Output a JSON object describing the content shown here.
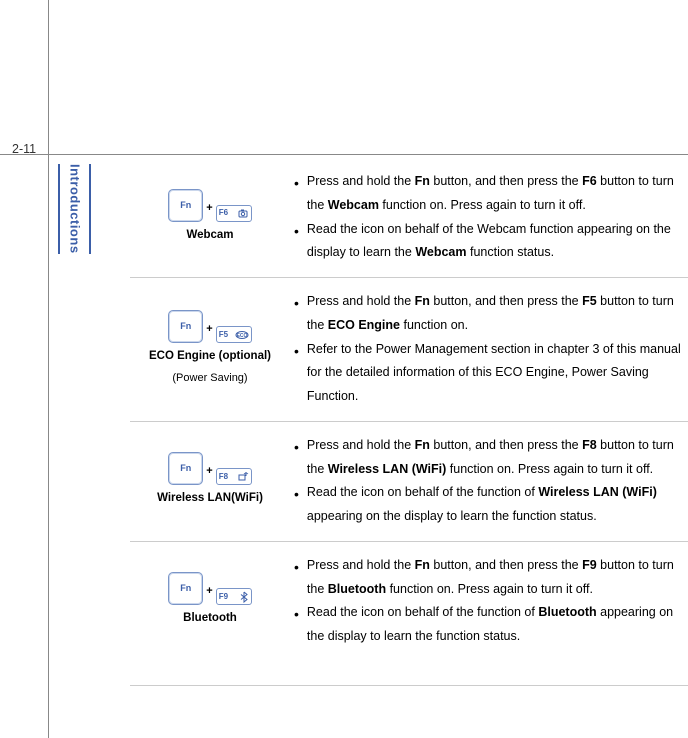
{
  "page_number": "2-11",
  "side_label": "Introductions",
  "fn_label": "Fn",
  "rows": [
    {
      "fkey": "F6",
      "icon": "camera",
      "title": "Webcam",
      "subtitle": "",
      "bullets": [
        {
          "pre": "Press and hold the ",
          "b1": "Fn",
          "mid1": " button, and then press the ",
          "b2": "F6",
          "mid2": " button to turn the ",
          "b3": "Webcam",
          "post": " function on.  Press again to turn it off."
        },
        {
          "pre": "Read the icon on behalf of the Webcam function appearing on the display to learn the ",
          "b1": "Webcam",
          "post": " function status."
        }
      ]
    },
    {
      "fkey": "F5",
      "icon": "eco",
      "title": "ECO Engine (optional)",
      "subtitle": "(Power Saving)",
      "bullets": [
        {
          "pre": "Press and hold the ",
          "b1": "Fn",
          "mid1": " button, and then press the ",
          "b2": "F5",
          "mid2": " button to turn the ",
          "b3": "ECO Engine",
          "post": " function on."
        },
        {
          "pre": "Refer to the Power Management section in chapter 3 of this manual for the detailed information of this ECO Engine, Power Saving Function.",
          "b1": "",
          "post": ""
        }
      ]
    },
    {
      "fkey": "F8",
      "icon": "wifi",
      "title": "Wireless LAN(WiFi)",
      "subtitle": "",
      "bullets": [
        {
          "pre": "Press and hold the ",
          "b1": "Fn",
          "mid1": " button, and then press the ",
          "b2": "F8",
          "mid2": " button to turn the ",
          "b3": "Wireless LAN (WiFi)",
          "post": " function on.  Press again to turn it off."
        },
        {
          "pre": "Read the icon on behalf of the function of ",
          "b1": "Wireless LAN (WiFi)",
          "post": " appearing on the display to learn the function status."
        }
      ]
    },
    {
      "fkey": "F9",
      "icon": "bluetooth",
      "title": "Bluetooth",
      "subtitle": "",
      "bullets": [
        {
          "pre": "Press and hold the ",
          "b1": "Fn",
          "mid1": " button, and then press the ",
          "b2": "F9",
          "mid2": " button to turn the ",
          "b3": "Bluetooth",
          "post": " function on.  Press again to turn it off."
        },
        {
          "pre": "Read the icon on behalf of the function of ",
          "b1": "Bluetooth",
          "post": " appearing on the display to learn the function status."
        }
      ]
    }
  ]
}
